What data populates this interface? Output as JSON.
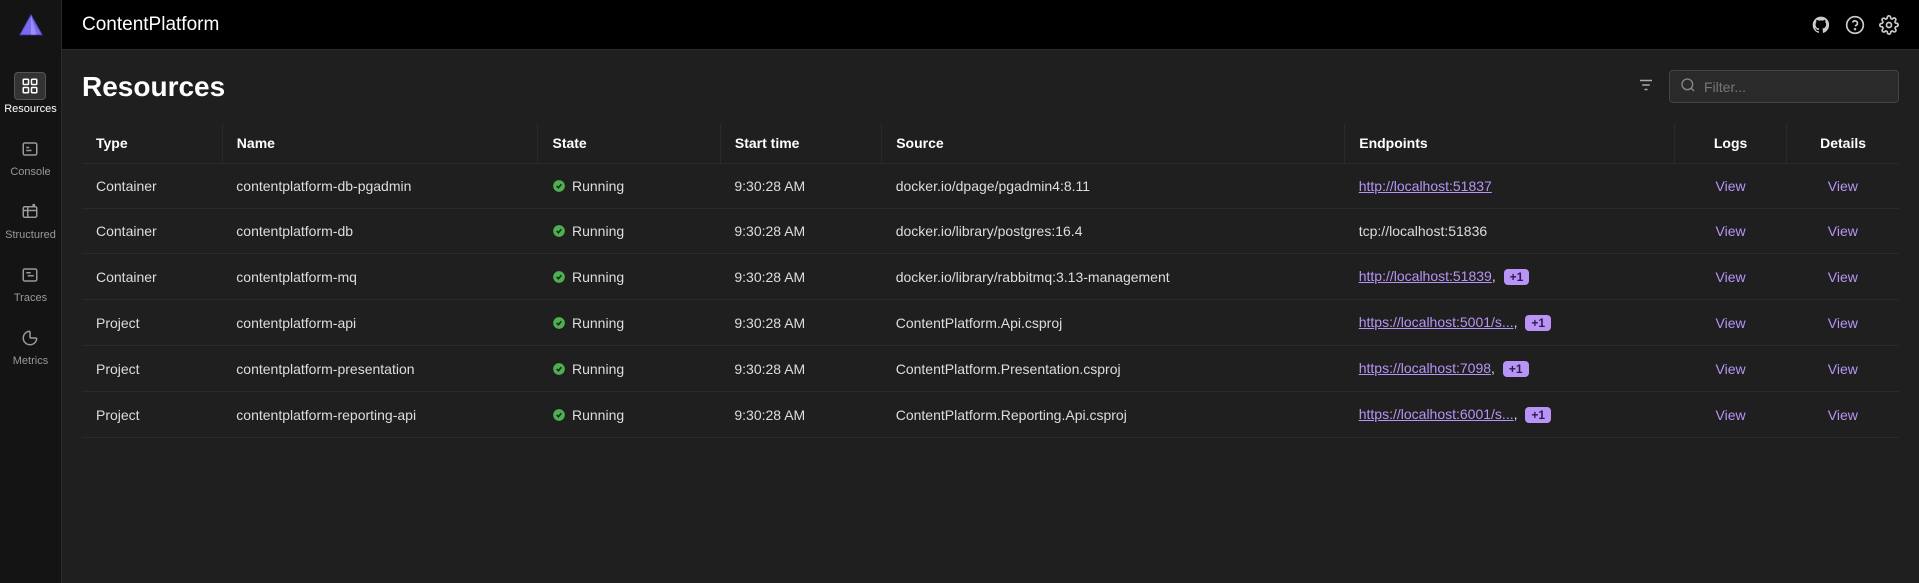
{
  "app": {
    "title": "ContentPlatform"
  },
  "sidebar": {
    "items": [
      {
        "label": "Resources",
        "icon": "grid",
        "active": true
      },
      {
        "label": "Console",
        "icon": "console",
        "active": false
      },
      {
        "label": "Structured",
        "icon": "structured",
        "active": false
      },
      {
        "label": "Traces",
        "icon": "traces",
        "active": false
      },
      {
        "label": "Metrics",
        "icon": "metrics",
        "active": false
      }
    ]
  },
  "page": {
    "title": "Resources"
  },
  "search": {
    "placeholder": "Filter..."
  },
  "table": {
    "columns": [
      "Type",
      "Name",
      "State",
      "Start time",
      "Source",
      "Endpoints",
      "Logs",
      "Details"
    ],
    "viewLabel": "View",
    "rows": [
      {
        "type": "Container",
        "name": "contentplatform-db-pgadmin",
        "state": "Running",
        "startTime": "9:30:28 AM",
        "source": "docker.io/dpage/pgadmin4:8.11",
        "endpoint": "http://localhost:51837",
        "endpointIsLink": true,
        "extraCount": null
      },
      {
        "type": "Container",
        "name": "contentplatform-db",
        "state": "Running",
        "startTime": "9:30:28 AM",
        "source": "docker.io/library/postgres:16.4",
        "endpoint": "tcp://localhost:51836",
        "endpointIsLink": false,
        "extraCount": null
      },
      {
        "type": "Container",
        "name": "contentplatform-mq",
        "state": "Running",
        "startTime": "9:30:28 AM",
        "source": "docker.io/library/rabbitmq:3.13-management",
        "endpoint": "http://localhost:51839",
        "endpointIsLink": true,
        "extraCount": "+1"
      },
      {
        "type": "Project",
        "name": "contentplatform-api",
        "state": "Running",
        "startTime": "9:30:28 AM",
        "source": "ContentPlatform.Api.csproj",
        "endpoint": "https://localhost:5001/s...",
        "endpointIsLink": true,
        "extraCount": "+1"
      },
      {
        "type": "Project",
        "name": "contentplatform-presentation",
        "state": "Running",
        "startTime": "9:30:28 AM",
        "source": "ContentPlatform.Presentation.csproj",
        "endpoint": "https://localhost:7098",
        "endpointIsLink": true,
        "extraCount": "+1"
      },
      {
        "type": "Project",
        "name": "contentplatform-reporting-api",
        "state": "Running",
        "startTime": "9:30:28 AM",
        "source": "ContentPlatform.Reporting.Api.csproj",
        "endpoint": "https://localhost:6001/s...",
        "endpointIsLink": true,
        "extraCount": "+1"
      }
    ]
  }
}
